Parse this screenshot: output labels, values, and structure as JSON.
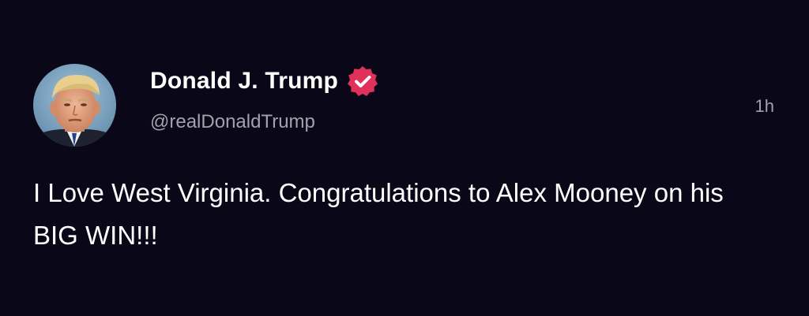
{
  "post": {
    "author": {
      "display_name": "Donald J. Trump",
      "handle": "@realDonaldTrump",
      "verified_icon": "verified-badge-icon",
      "verified_color": "#e0315a",
      "avatar_icon": "profile-photo"
    },
    "timestamp": "1h",
    "text": "I Love West Virginia. Congratulations to Alex Mooney on his BIG WIN!!!"
  },
  "theme": {
    "background": "#0a0818",
    "primary_text": "#ffffff",
    "secondary_text": "#a3a1ad"
  }
}
